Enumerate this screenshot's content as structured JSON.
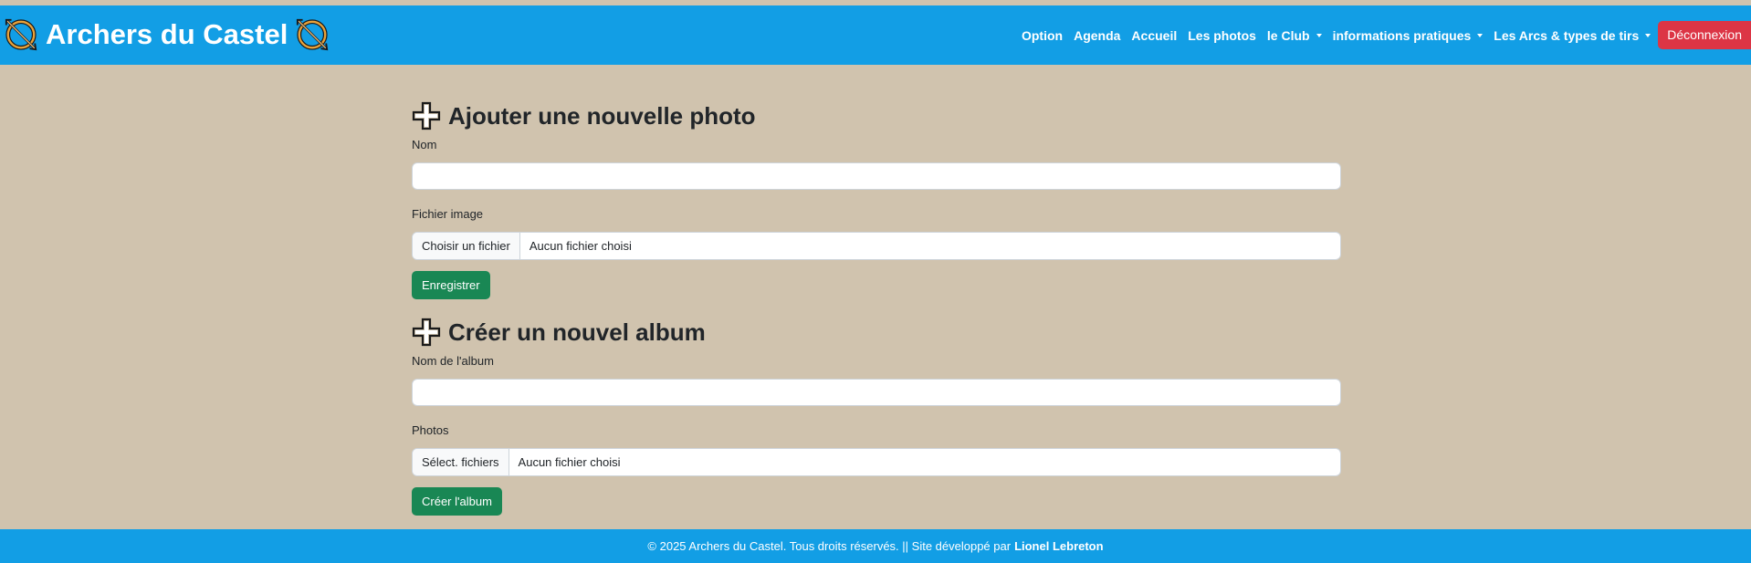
{
  "brand": {
    "title": "Archers du Castel",
    "icon": "bow-arrow-icon"
  },
  "nav": {
    "items": [
      {
        "label": "Option",
        "dropdown": false
      },
      {
        "label": "Agenda",
        "dropdown": false
      },
      {
        "label": "Accueil",
        "dropdown": false
      },
      {
        "label": "Les photos",
        "dropdown": false
      },
      {
        "label": "le Club",
        "dropdown": true
      },
      {
        "label": "informations pratiques",
        "dropdown": true
      },
      {
        "label": "Les Arcs & types de tirs",
        "dropdown": true
      }
    ],
    "logout_label": "Déconnexion"
  },
  "add_photo": {
    "title": "Ajouter une nouvelle photo",
    "name_label": "Nom",
    "name_value": "",
    "file_label": "Fichier image",
    "file_button": "Choisir un fichier",
    "file_status": "Aucun fichier choisi",
    "submit_label": "Enregistrer"
  },
  "create_album": {
    "title": "Créer un nouvel album",
    "name_label": "Nom de l'album",
    "name_value": "",
    "photos_label": "Photos",
    "file_button": "Sélect. fichiers",
    "file_status": "Aucun fichier choisi",
    "submit_label": "Créer l'album"
  },
  "footer": {
    "text": "© 2025 Archers du Castel. Tous droits réservés. || Site développé par",
    "author": "Lionel Lebreton"
  },
  "colors": {
    "navbar": "#129ee5",
    "background": "#d0c3ae",
    "success": "#198754",
    "danger": "#dc3545"
  }
}
